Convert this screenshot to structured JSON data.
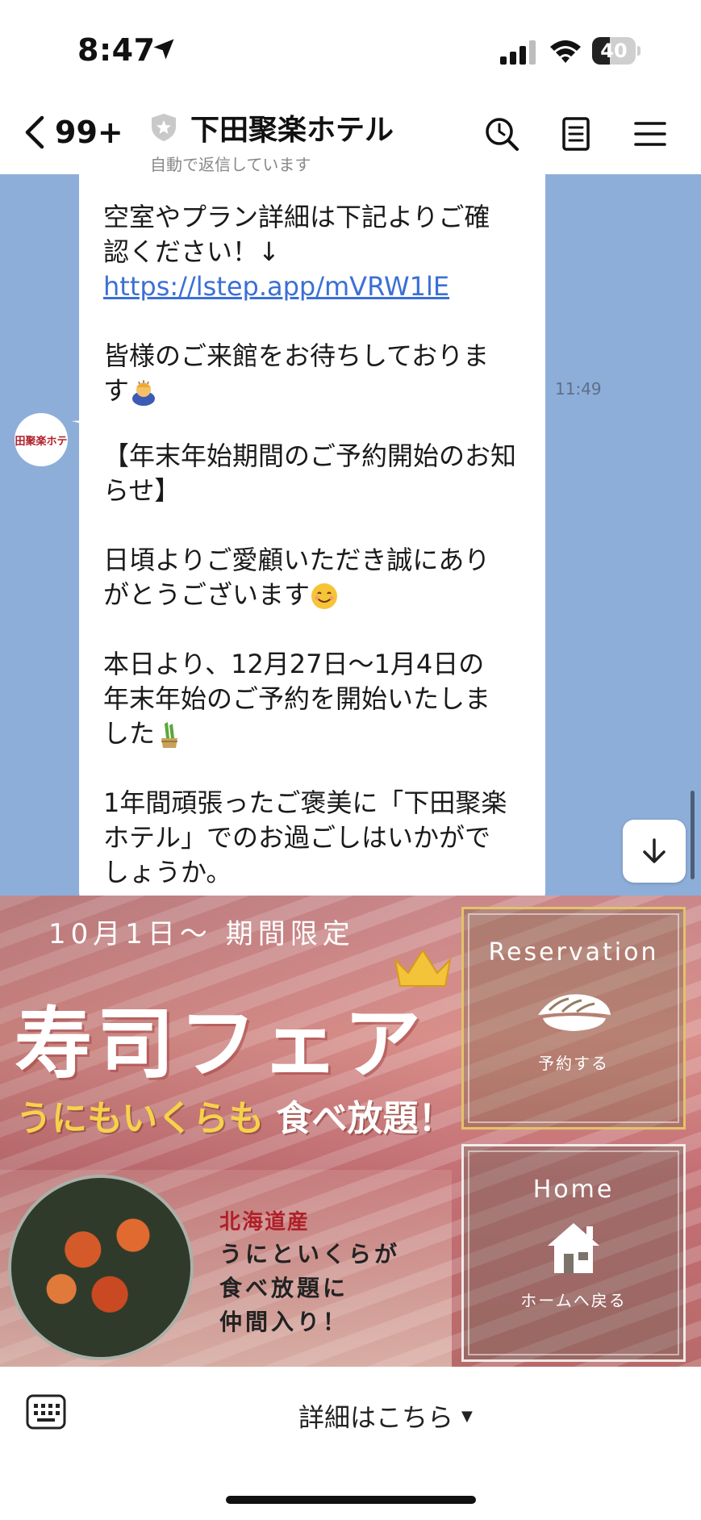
{
  "status_bar": {
    "time": "8:47",
    "battery_percent": "40",
    "battery_level": 0.4
  },
  "header": {
    "back_count": "99+",
    "title": "下田聚楽ホテル",
    "subtitle": "自動で返信しています"
  },
  "messages": [
    {
      "lines": [
        "空室やプラン詳細は下記よりご確",
        "認ください！↓"
      ],
      "link": "https://lstep.app/mVRW1lE",
      "closing": [
        "皆様のご来館をお待ちしておりま",
        "す"
      ],
      "time": "11:49"
    },
    {
      "p1": [
        "【年末年始期間のご予約開始のお知",
        "らせ】"
      ],
      "p2": [
        "日頃よりご愛顧いただき誠にあり",
        "がとうございます"
      ],
      "p3": [
        "本日より、12月27日〜1月4日の",
        "年末年始のご予約を開始いたしま",
        "した"
      ],
      "p4": [
        "1年間頑張ったご褒美に「下田聚楽",
        "ホテル」でのお過ごしはいかがで",
        "しょうか。"
      ]
    }
  ],
  "avatar_text": "下田聚楽ホテル",
  "rich_menu": {
    "period": "10月1日〜 期間限定",
    "title": "寿司フェア",
    "tagline_colored": "うにもいくらも",
    "tagline_white": "食べ放題！",
    "origin": "北海道産",
    "desc": [
      "うにといくらが",
      "食べ放題に",
      "仲間入り！"
    ],
    "reservation": {
      "title": "Reservation",
      "sub": "予約する"
    },
    "home": {
      "title": "Home",
      "sub": "ホームへ戻る"
    }
  },
  "bottom_bar": {
    "menu_label": "詳細はこちら",
    "menu_arrow": "▼"
  },
  "colors": {
    "chat_bg": "#8daed9",
    "link": "#3b6fd6",
    "accent_gold": "#f6d24a"
  }
}
